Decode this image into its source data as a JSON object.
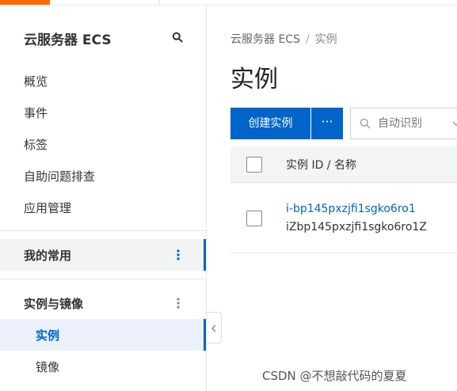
{
  "sidebar": {
    "title": "云服务器 ECS",
    "items": [
      {
        "label": "概览"
      },
      {
        "label": "事件"
      },
      {
        "label": "标签"
      },
      {
        "label": "自助问题排查"
      },
      {
        "label": "应用管理"
      }
    ],
    "favorites_label": "我的常用",
    "group_label": "实例与镜像",
    "sub_items": [
      {
        "label": "实例",
        "active": true
      },
      {
        "label": "镜像",
        "active": false
      }
    ]
  },
  "breadcrumb": {
    "root": "云服务器 ECS",
    "separator": "/",
    "current": "实例"
  },
  "page_title": "实例",
  "toolbar": {
    "create_label": "创建实例",
    "more_label": "···",
    "search_placeholder": "自动识别"
  },
  "table": {
    "header": "实例 ID / 名称",
    "rows": [
      {
        "id": "i-bp145pxzjfi1sgko6ro1",
        "name": "iZbp145pxzjfi1sgko6ro1Z"
      }
    ]
  },
  "watermark": "CSDN @不想敲代码的夏夏",
  "colors": {
    "brand": "#ff6a00",
    "primary": "#0064c8",
    "active_bg": "#eaf1fb"
  },
  "icons": [
    "search-icon",
    "more-vertical-icon",
    "chevron-left-icon",
    "chevron-down-icon",
    "checkbox-icon"
  ]
}
